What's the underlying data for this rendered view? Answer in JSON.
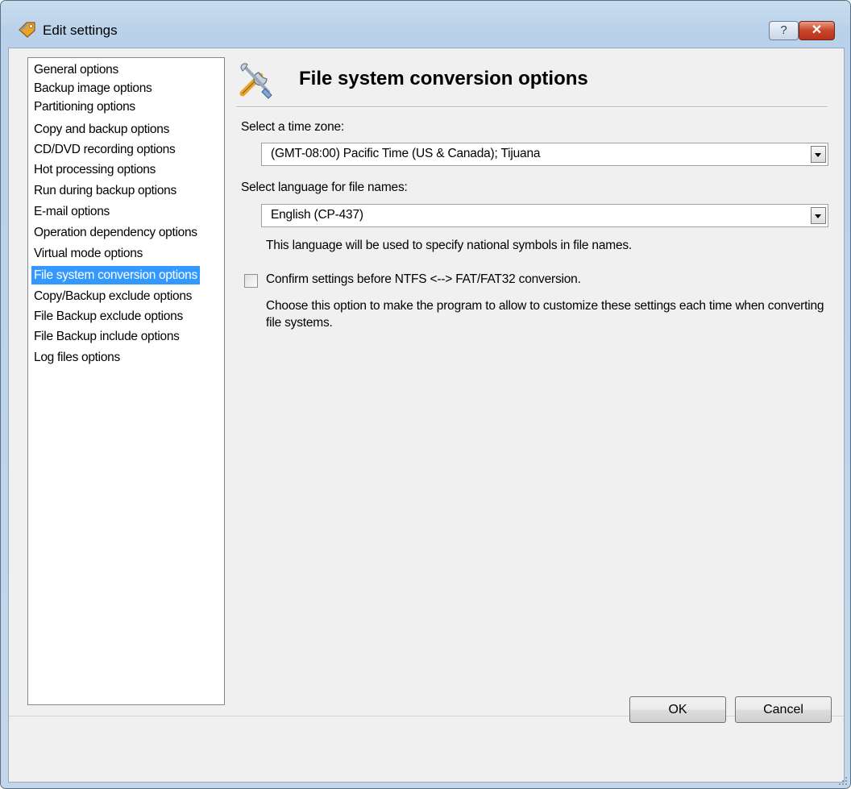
{
  "window": {
    "title": "Edit settings",
    "help_label": "?",
    "close_label": "✕"
  },
  "nav": {
    "items": [
      {
        "label": "General options",
        "selected": false
      },
      {
        "label": "Backup image options",
        "selected": false
      },
      {
        "label": "Partitioning options",
        "selected": false
      },
      {
        "label": "Copy and backup options",
        "selected": false
      },
      {
        "label": "CD/DVD recording options",
        "selected": false
      },
      {
        "label": "Hot processing options",
        "selected": false
      },
      {
        "label": "Run during backup options",
        "selected": false
      },
      {
        "label": "E-mail options",
        "selected": false
      },
      {
        "label": "Operation dependency options",
        "selected": false
      },
      {
        "label": "Virtual mode options",
        "selected": false
      },
      {
        "label": "File system conversion options",
        "selected": true
      },
      {
        "label": "Copy/Backup exclude options",
        "selected": false
      },
      {
        "label": "File Backup exclude options",
        "selected": false
      },
      {
        "label": "File Backup include options",
        "selected": false
      },
      {
        "label": "Log files options",
        "selected": false
      }
    ]
  },
  "panel": {
    "title": "File system conversion options",
    "icon": "tools-icon",
    "timezone": {
      "label": "Select a time zone:",
      "value": "(GMT-08:00) Pacific Time (US & Canada); Tijuana"
    },
    "language": {
      "label": "Select language for file names:",
      "value": "English (CP-437)",
      "hint": "This language will be used to specify national symbols in file names."
    },
    "confirm": {
      "label": "Confirm settings before NTFS <--> FAT/FAT32 conversion.",
      "checked": false,
      "description": "Choose this option to make the program to allow to customize these settings each time when converting file systems."
    }
  },
  "buttons": {
    "ok": "OK",
    "cancel": "Cancel"
  },
  "colors": {
    "selection": "#3399ff",
    "title_bar": "#b9d1ea",
    "close_button": "#c8452a"
  }
}
